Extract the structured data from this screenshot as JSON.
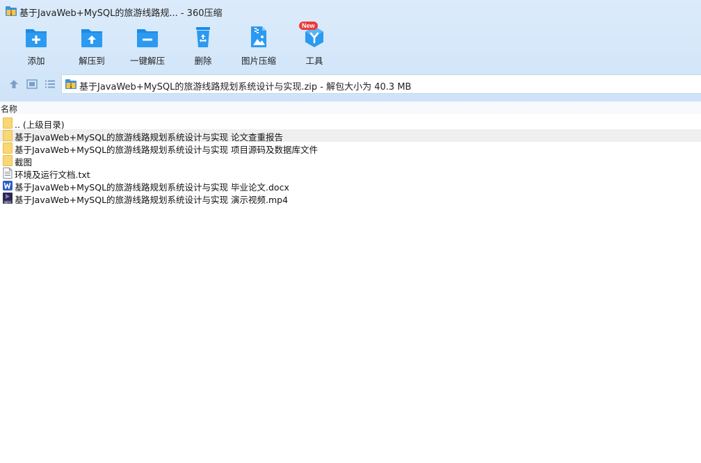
{
  "window": {
    "title": "基于JavaWeb+MySQL的旅游线路规... - 360压缩"
  },
  "toolbar": {
    "items": [
      {
        "label": "添加",
        "icon": "add-folder-icon"
      },
      {
        "label": "解压到",
        "icon": "extract-to-icon"
      },
      {
        "label": "一键解压",
        "icon": "one-click-extract-icon"
      },
      {
        "label": "删除",
        "icon": "recycle-bin-icon"
      },
      {
        "label": "图片压缩",
        "icon": "image-compress-icon"
      },
      {
        "label": "工具",
        "icon": "tools-cube-icon",
        "badge": "New"
      }
    ]
  },
  "address": {
    "text": "基于JavaWeb+MySQL的旅游线路规划系统设计与实现.zip - 解包大小为 40.3 MB"
  },
  "columns": {
    "name": "名称"
  },
  "files": [
    {
      "name": ".. (上级目录)",
      "type": "folder"
    },
    {
      "name": "基于JavaWeb+MySQL的旅游线路规划系统设计与实现 论文查重报告",
      "type": "folder"
    },
    {
      "name": "基于JavaWeb+MySQL的旅游线路规划系统设计与实现 项目源码及数据库文件",
      "type": "folder"
    },
    {
      "name": "截图",
      "type": "folder"
    },
    {
      "name": "环境及运行文档.txt",
      "type": "txt"
    },
    {
      "name": "基于JavaWeb+MySQL的旅游线路规划系统设计与实现 毕业论文.docx",
      "type": "docx"
    },
    {
      "name": "基于JavaWeb+MySQL的旅游线路规划系统设计与实现 演示视频.mp4",
      "type": "mp4"
    }
  ],
  "colors": {
    "accent": "#1a8be8",
    "folder": "#f8d775",
    "badge": "#ea3b38"
  }
}
